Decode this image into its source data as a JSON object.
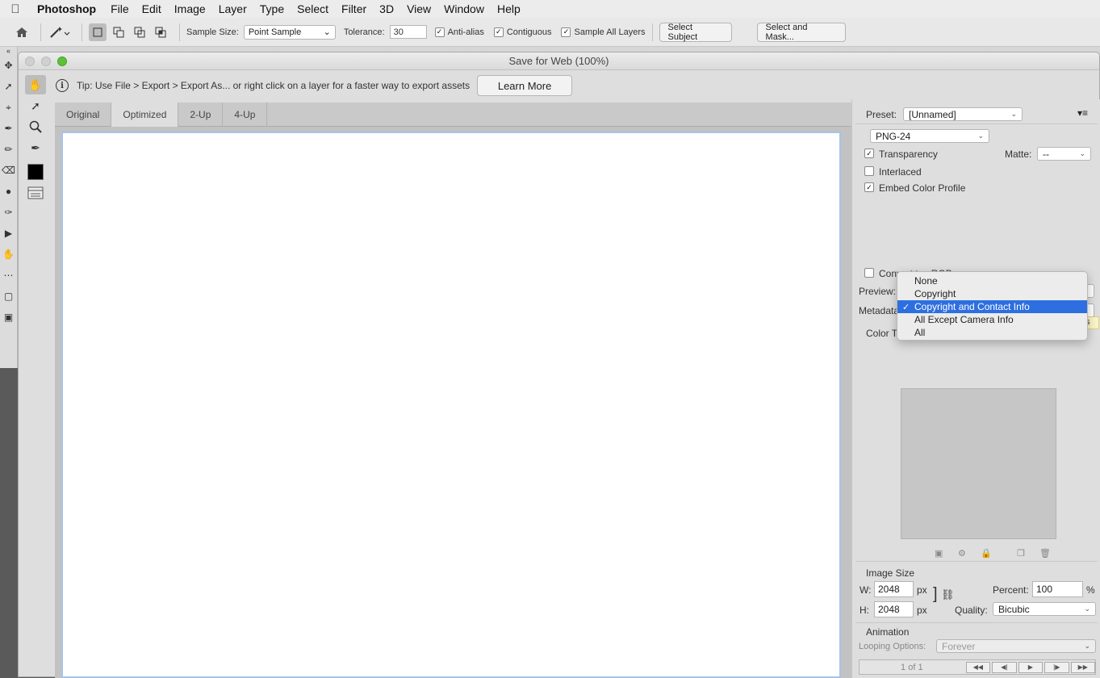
{
  "menubar": {
    "apple": "",
    "app": "Photoshop",
    "items": [
      "File",
      "Edit",
      "Image",
      "Layer",
      "Type",
      "Select",
      "Filter",
      "3D",
      "View",
      "Window",
      "Help"
    ]
  },
  "options": {
    "sample_size_label": "Sample Size:",
    "sample_size_value": "Point Sample",
    "tolerance_label": "Tolerance:",
    "tolerance_value": "30",
    "anti_alias": "Anti-alias",
    "contiguous": "Contiguous",
    "sample_all_layers": "Sample All Layers",
    "select_subject": "Select Subject",
    "select_and_mask": "Select and Mask..."
  },
  "dialog": {
    "title": "Save for Web (100%)",
    "tip": "Tip: Use File > Export > Export As...  or right click on a layer for a faster way to export assets",
    "learn_more": "Learn More",
    "tabs": [
      "Original",
      "Optimized",
      "2-Up",
      "4-Up"
    ],
    "active_tab": "Optimized"
  },
  "panel": {
    "preset_label": "Preset:",
    "preset_value": "[Unnamed]",
    "format_value": "PNG-24",
    "transparency": "Transparency",
    "matte_label": "Matte:",
    "matte_value": "--",
    "interlaced": "Interlaced",
    "embed_color_profile": "Embed Color Profile",
    "convert_srgb": "Convert to sRGB",
    "preview_label": "Preview:",
    "metadata_label": "Metadata:",
    "color_table_label": "Color Table",
    "image_size_label": "Image Size",
    "w_label": "W:",
    "w_value": "2048",
    "h_label": "H:",
    "h_value": "2048",
    "px": "px",
    "percent_label": "Percent:",
    "percent_value": "100",
    "percent_sign": "%",
    "quality_label": "Quality:",
    "quality_value": "Bicubic",
    "animation_label": "Animation",
    "looping_label": "Looping Options:",
    "looping_value": "Forever",
    "frame_counter": "1 of 1"
  },
  "metadata_menu": {
    "options": [
      "None",
      "Copyright",
      "Copyright and Contact Info",
      "All Except Camera Info",
      "All"
    ],
    "selected": "Copyright and Contact Info"
  },
  "tooltip_fragment": "s",
  "colors": {
    "accent": "#2d6fe0",
    "close": "#d0d0d0",
    "zoom": "#5fc03a"
  }
}
